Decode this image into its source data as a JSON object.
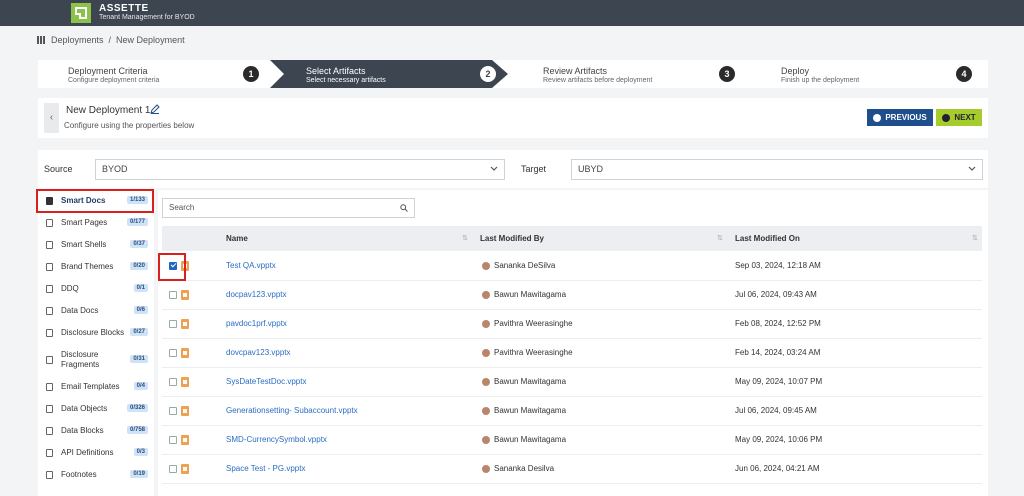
{
  "app": {
    "name": "ASSETTE",
    "subtitle": "Tenant Management for BYOD"
  },
  "breadcrumb": {
    "home": "Deployments",
    "sep": "/",
    "current": "New Deployment"
  },
  "steps": [
    {
      "title": "Deployment Criteria",
      "sub": "Configure deployment criteria",
      "num": "1"
    },
    {
      "title": "Select Artifacts",
      "sub": "Select necessary artifacts",
      "num": "2"
    },
    {
      "title": "Review Artifacts",
      "sub": "Review artifacts before deployment",
      "num": "3"
    },
    {
      "title": "Deploy",
      "sub": "Finish up the deployment",
      "num": "4"
    }
  ],
  "header": {
    "back": "‹",
    "title": "New Deployment 1",
    "subtitle": "Configure using the properties below",
    "prev_label": "PREVIOUS",
    "next_label": "NEXT"
  },
  "filters": {
    "source_label": "Source",
    "source_value": "BYOD",
    "target_label": "Target",
    "target_value": "UBYD"
  },
  "sidebar": {
    "items": [
      {
        "label": "Smart Docs",
        "count": "1/133"
      },
      {
        "label": "Smart Pages",
        "count": "0/177"
      },
      {
        "label": "Smart Shells",
        "count": "0/37"
      },
      {
        "label": "Brand Themes",
        "count": "0/20"
      },
      {
        "label": "DDQ",
        "count": "0/1"
      },
      {
        "label": "Data Docs",
        "count": "0/6"
      },
      {
        "label": "Disclosure Blocks",
        "count": "0/27"
      },
      {
        "label": "Disclosure Fragments",
        "count": "0/31"
      },
      {
        "label": "Email Templates",
        "count": "0/4"
      },
      {
        "label": "Data Objects",
        "count": "0/326"
      },
      {
        "label": "Data Blocks",
        "count": "0/758"
      },
      {
        "label": "API Definitions",
        "count": "0/3"
      },
      {
        "label": "Footnotes",
        "count": "0/19"
      }
    ]
  },
  "table": {
    "search_placeholder": "Search",
    "columns": [
      "Name",
      "Last Modified By",
      "Last Modified On"
    ],
    "rows": [
      {
        "name": "Test QA.vpptx",
        "by": "Sananka DeSilva",
        "on": "Sep 03, 2024, 12:18 AM",
        "checked": true
      },
      {
        "name": "docpav123.vpptx",
        "by": "Bawun Mawitagama",
        "on": "Jul 06, 2024, 09:43 AM",
        "checked": false
      },
      {
        "name": "pavdoc1prf.vpptx",
        "by": "Pavithra Weerasinghe",
        "on": "Feb 08, 2024, 12:52 PM",
        "checked": false
      },
      {
        "name": "dovcpav123.vpptx",
        "by": "Pavithra Weerasinghe",
        "on": "Feb 14, 2024, 03:24 AM",
        "checked": false
      },
      {
        "name": "SysDateTestDoc.vpptx",
        "by": "Bawun Mawitagama",
        "on": "May 09, 2024, 10:07 PM",
        "checked": false
      },
      {
        "name": "Generationsetting- Subaccount.vpptx",
        "by": "Bawun Mawitagama",
        "on": "Jul 06, 2024, 09:45 AM",
        "checked": false
      },
      {
        "name": "SMD-CurrencySymbol.vpptx",
        "by": "Bawun Mawitagama",
        "on": "May 09, 2024, 10:06 PM",
        "checked": false
      },
      {
        "name": "Space Test - PG.vpptx",
        "by": "Sananka Desilva",
        "on": "Jun 06, 2024, 04:21 AM",
        "checked": false
      }
    ]
  },
  "colors": {
    "topbar": "#3d4551",
    "accent_green": "#a5cc2a",
    "accent_blue": "#1f4e8c",
    "highlight_red": "#d9201d"
  }
}
